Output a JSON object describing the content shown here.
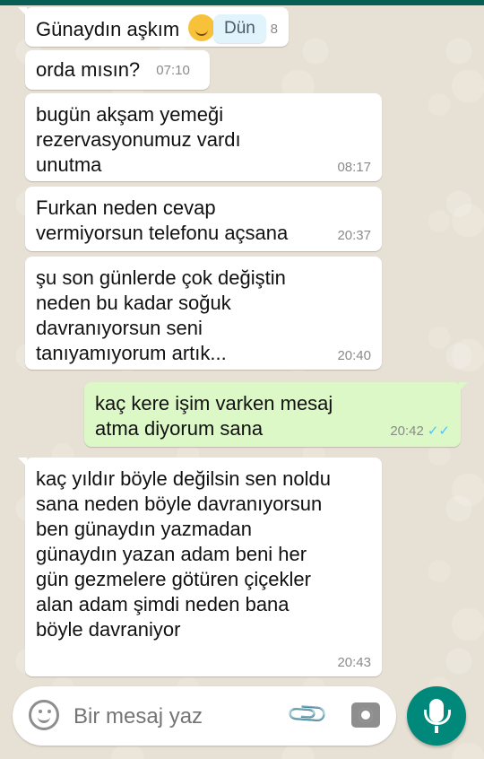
{
  "date_chip": "Dün",
  "messages": [
    {
      "text": "Günaydın aşkım",
      "time": "8",
      "direction": "in",
      "emoji": "hugging-face"
    },
    {
      "text": "orda mısın?",
      "time": "07:10",
      "direction": "in"
    },
    {
      "text": "bugün akşam yemeği rezervasyonumuz vardı unutma",
      "time": "08:17",
      "direction": "in"
    },
    {
      "text": "Furkan neden cevap vermiyorsun telefonu açsana",
      "time": "20:37",
      "direction": "in"
    },
    {
      "text": "şu son günlerde çok değiştin neden bu kadar soğuk davranıyorsun seni tanıyamıyorum artık...",
      "time": "20:40",
      "direction": "in"
    },
    {
      "text": "kaç kere işim varken mesaj atma diyorum sana",
      "time": "20:42",
      "direction": "out",
      "ticks": "✓✓"
    },
    {
      "text": "kaç yıldır böyle değilsin sen noldu sana neden böyle davranıyorsun ben günaydın yazmadan günaydın yazan adam beni her gün gezmelere götüren çiçekler alan adam şimdi neden bana böyle davraniyor",
      "time": "20:43",
      "direction": "in"
    }
  ],
  "composer": {
    "placeholder": "Bir mesaj yaz",
    "icons": [
      "emoji-icon",
      "paperclip-icon",
      "camera-icon",
      "microphone-icon"
    ]
  },
  "colors": {
    "incoming_bubble": "#ffffff",
    "outgoing_bubble": "#dcf8c6",
    "read_ticks": "#4fc3f7",
    "mic_button": "#00897b",
    "header": "#075e54"
  }
}
